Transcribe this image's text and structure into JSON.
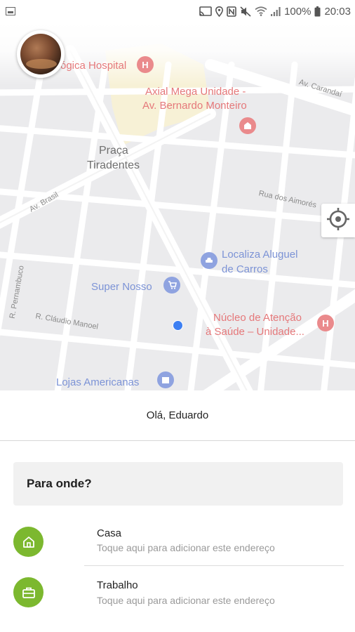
{
  "status_bar": {
    "battery": "100%",
    "time": "20:03",
    "icons": [
      "gallery-notification-icon",
      "cast-icon",
      "location-icon",
      "nfc-icon",
      "mute-icon",
      "wifi-icon",
      "signal-icon",
      "battery-icon"
    ]
  },
  "map": {
    "pois": [
      {
        "name": "hospital-partial",
        "label": "ógica Hospital",
        "color": "#e5787a"
      },
      {
        "name": "axial-mega",
        "label_line1": "Axial Mega Unidade -",
        "label_line2": "Av. Bernardo Monteiro",
        "color": "#e5787a"
      },
      {
        "name": "praca-tiradentes",
        "label_line1": "Praça",
        "label_line2": "Tiradentes"
      },
      {
        "name": "localiza",
        "label_line1": "Localiza Aluguel",
        "label_line2": "de Carros",
        "color": "#7c93d6"
      },
      {
        "name": "super-nosso",
        "label": "Super Nosso",
        "color": "#7c93d6"
      },
      {
        "name": "nucleo",
        "label_line1": "Núcleo de Atenção",
        "label_line2": "à Saúde – Unidade...",
        "color": "#e5787a"
      },
      {
        "name": "lojas-americanas",
        "label": "Lojas Americanas",
        "color": "#7c93d6"
      }
    ],
    "streets": {
      "av_carandai": "Av. Carandaí",
      "av_brasil": "Av. Brasil",
      "rua_aimores": "Rua dos Aimorés",
      "r_pernambuco": "R. Pernambuco",
      "r_claudio_manoel": "R. Cláudio Manoel"
    },
    "hospital_pin": "H"
  },
  "greeting": "Olá, Eduardo",
  "destination": {
    "label": "Para onde?"
  },
  "addresses": [
    {
      "title": "Casa",
      "subtitle": "Toque aqui para adicionar este endereço",
      "icon": "home-icon"
    },
    {
      "title": "Trabalho",
      "subtitle": "Toque aqui para adicionar este endereço",
      "icon": "briefcase-icon"
    }
  ],
  "colors": {
    "accent_green": "#7cb82f",
    "user_location_blue": "#3d7ff2"
  }
}
